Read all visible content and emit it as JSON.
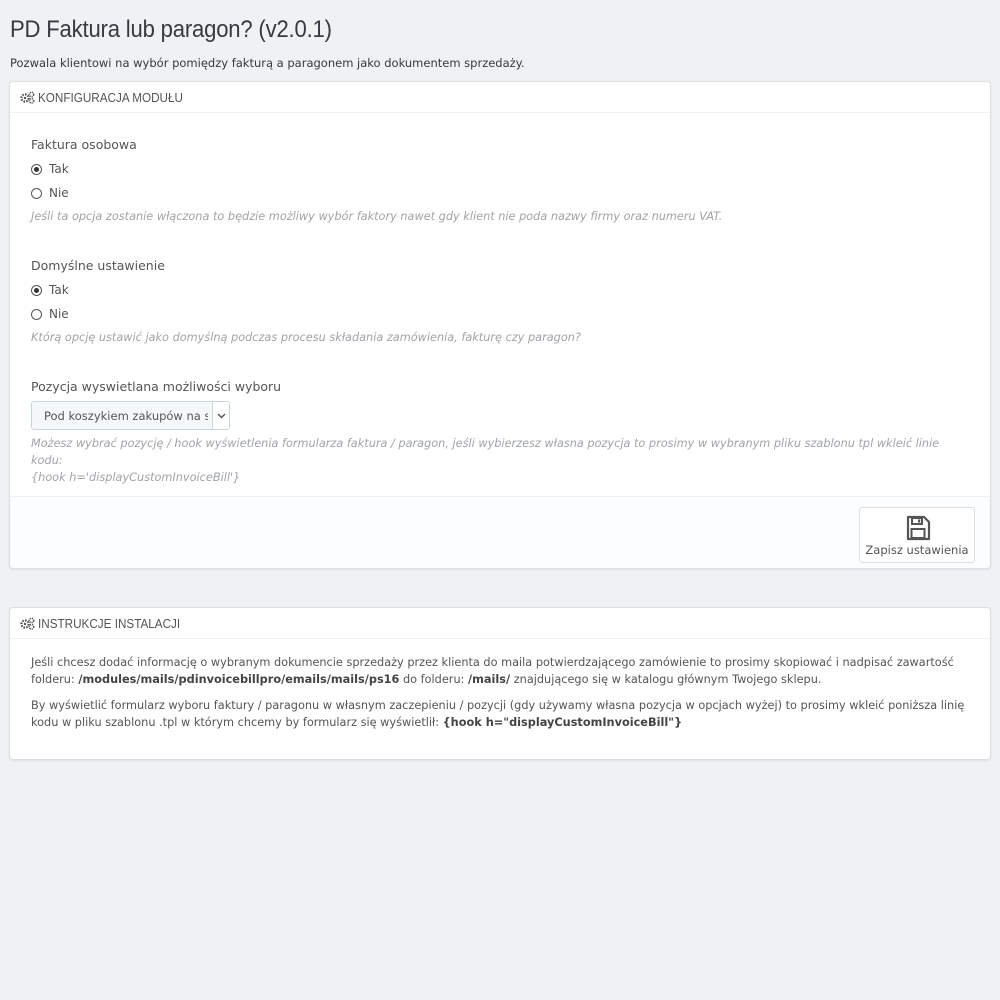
{
  "page": {
    "title": "PD Faktura lub paragon? (v2.0.1)",
    "description": "Pozwala klientowi na wybór pomiędzy fakturą a paragonem jako dokumentem sprzedaży."
  },
  "config_panel": {
    "heading": "KONFIGURACJA MODUŁU",
    "heading_icon": "cogs-icon",
    "personal_invoice": {
      "label": "Faktura osobowa",
      "options": [
        {
          "label": "Tak",
          "checked": true
        },
        {
          "label": "Nie",
          "checked": false
        }
      ],
      "help": "Jeśli ta opcja zostanie włączona to będzie możliwy wybór faktory nawet gdy klient nie poda nazwy firmy oraz numeru VAT."
    },
    "default_setting": {
      "label": "Domyślne ustawienie",
      "options": [
        {
          "label": "Tak",
          "checked": true
        },
        {
          "label": "Nie",
          "checked": false
        }
      ],
      "help": "Którą opcję ustawić jako domyślną podczas procesu składania zamówienia, fakturę czy paragon?"
    },
    "position": {
      "label": "Pozycja wyswietlana możliwości wyboru",
      "selected": "Pod koszykiem zakupów na s",
      "help_line1": "Możesz wybrać pozycję / hook wyświetlenia formularza faktura / paragon, jeśli wybierzesz własna pozycja to prosimy w wybranym pliku szablonu tpl wkleić linie kodu:",
      "help_line2": "{hook h='displayCustomInvoiceBill'}"
    },
    "save_label": "Zapisz ustawienia",
    "save_icon": "floppy-disk-icon"
  },
  "install_panel": {
    "heading": "INSTRUKCJE INSTALACJI",
    "heading_icon": "cogs-icon",
    "p1_text1": "Jeśli chcesz dodać informację o wybranym dokumencie sprzedaży przez klienta do maila potwierdzającego zamówienie to prosimy skopiować i nadpisać zawartość folderu: ",
    "p1_bold1": "/modules/mails/pdinvoicebillpro/emails/mails/ps16",
    "p1_text2": " do folderu: ",
    "p1_bold2": "/mails/",
    "p1_text3": " znajdującego się w katalogu głównym Twojego sklepu.",
    "p2_text1": "By wyświetlić formularz wyboru faktury / paragonu w własnym zaczepieniu / pozycji (gdy używamy własna pozycja w opcjach wyżej) to prosimy wkleić poniższa linię kodu w pliku szablonu .tpl w którym chcemy by formularz się wyświetlił: ",
    "p2_bold1": "{hook h=\"displayCustomInvoiceBill\"}"
  }
}
